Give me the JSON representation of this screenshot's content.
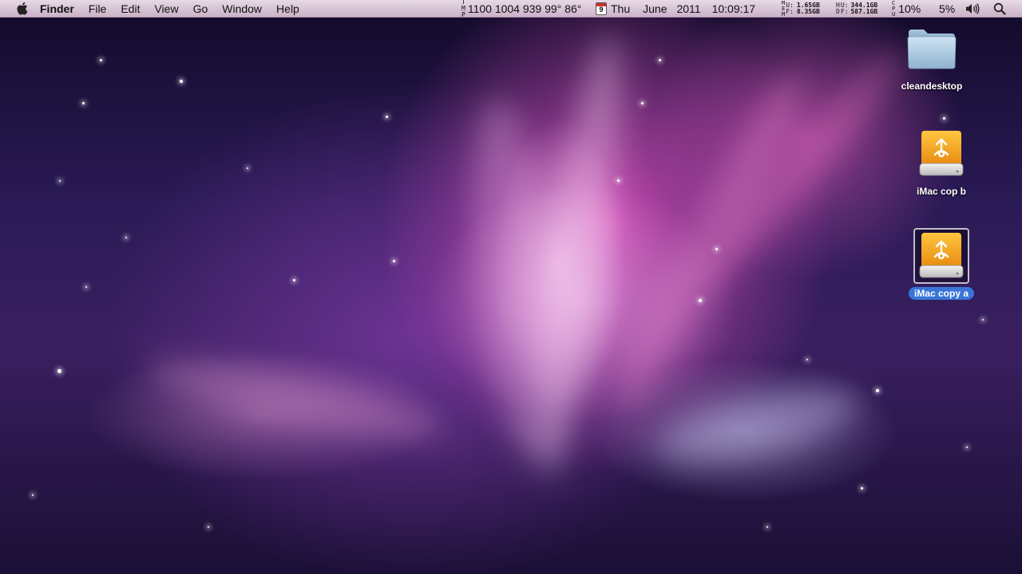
{
  "menubar": {
    "app_name": "Finder",
    "menus": [
      "File",
      "Edit",
      "View",
      "Go",
      "Window",
      "Help"
    ],
    "temp_letters": [
      "T",
      "M",
      "P"
    ],
    "sensors": "1100 1004 939 99° 86°",
    "calendar_day": "9",
    "day": "Thu",
    "month": "June",
    "year": "2011",
    "time": "10:09:17",
    "mem_letters": [
      "M",
      "E",
      "M"
    ],
    "mem_used_label": "U:",
    "mem_free_label": "F:",
    "mem_used": "1.65GB",
    "mem_free": "8.35GB",
    "hd_letters": [
      "H",
      "D"
    ],
    "hd_used_label": "U:",
    "hd_free_label": "F:",
    "hd_used": "344.1GB",
    "hd_free": "587.1GB",
    "cpu_letters": [
      "C",
      "P",
      "U"
    ],
    "cpu_percent": "10%",
    "battery_percent": "5%",
    "icons": {
      "apple": "apple-icon",
      "volume": "volume-icon",
      "spotlight": "search-icon"
    }
  },
  "desktop": {
    "icons": [
      {
        "label": "cleandesktop",
        "kind": "folder",
        "selected": false
      },
      {
        "label": "iMac cop b",
        "kind": "firewire-drive",
        "selected": false
      },
      {
        "label": "iMac copy a",
        "kind": "firewire-drive",
        "selected": true
      }
    ]
  },
  "colors": {
    "selection": "#3875d7",
    "drive_orange": "#f0a020"
  }
}
